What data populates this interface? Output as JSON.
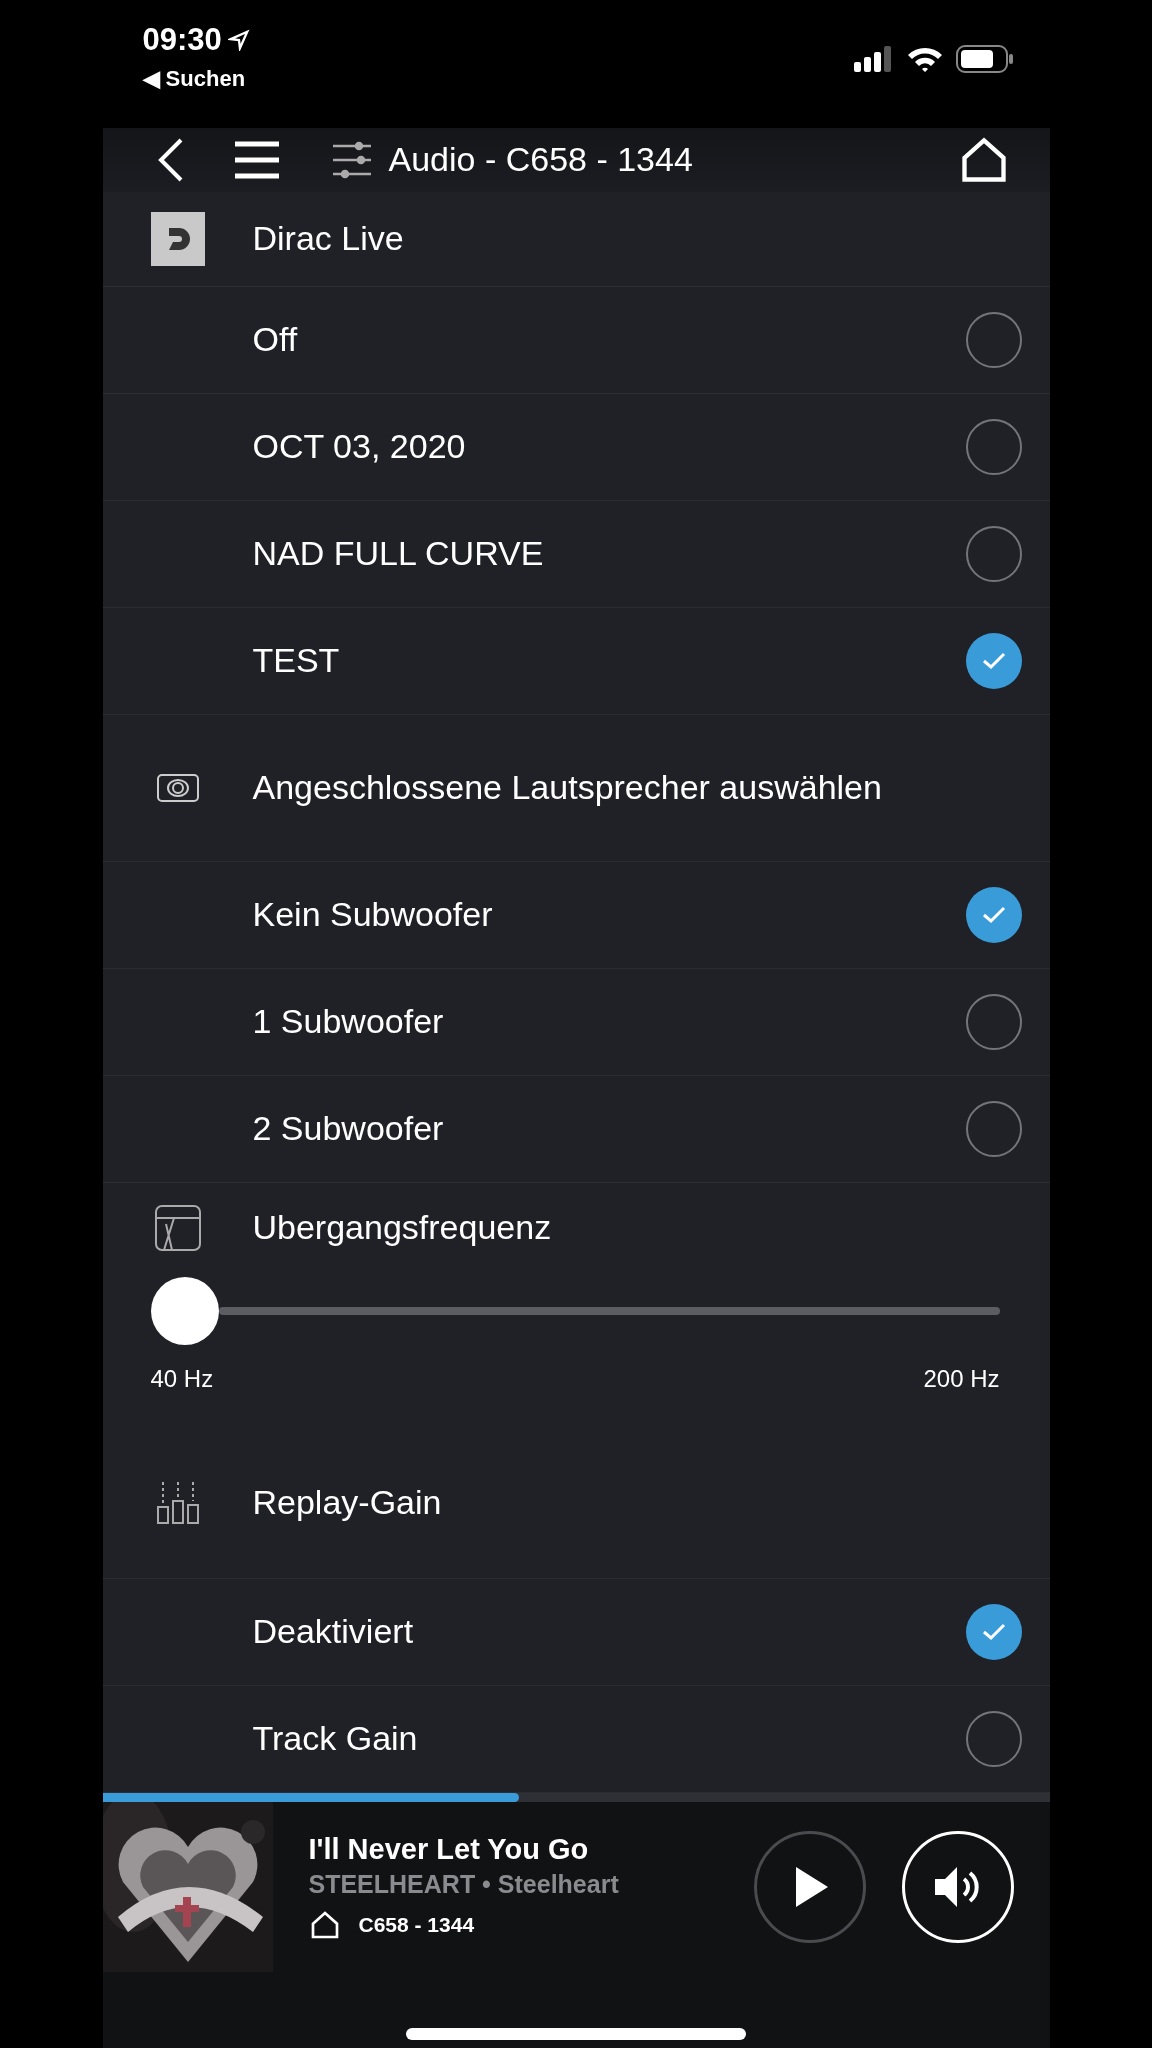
{
  "status_bar": {
    "time": "09:30",
    "back_label": "◀ Suchen"
  },
  "header": {
    "title": "Audio - C658 - 1344"
  },
  "sections": [
    {
      "kind": "options",
      "title": "Dirac Live",
      "options": [
        {
          "label": "Off",
          "selected": false
        },
        {
          "label": "OCT 03, 2020",
          "selected": false
        },
        {
          "label": "NAD FULL CURVE",
          "selected": false
        },
        {
          "label": "TEST",
          "selected": true
        }
      ]
    },
    {
      "kind": "options",
      "title": "Angeschlossene Lautsprecher auswählen",
      "options": [
        {
          "label": "Kein Subwoofer",
          "selected": true
        },
        {
          "label": "1 Subwoofer",
          "selected": false
        },
        {
          "label": "2 Subwoofer",
          "selected": false
        }
      ]
    },
    {
      "kind": "slider",
      "title": "Ubergangsfrequenz",
      "level": 0,
      "min_label": "40 Hz",
      "max_label": "200 Hz"
    },
    {
      "kind": "options",
      "title": "Replay-Gain",
      "options": [
        {
          "label": "Deaktiviert",
          "selected": true
        },
        {
          "label": "Track Gain",
          "selected": false
        }
      ]
    }
  ],
  "player": {
    "level": 0.44,
    "track": "I'll Never Let You Go",
    "artist": "STEELHEART • Steelheart",
    "device": "C658 - 1344"
  }
}
